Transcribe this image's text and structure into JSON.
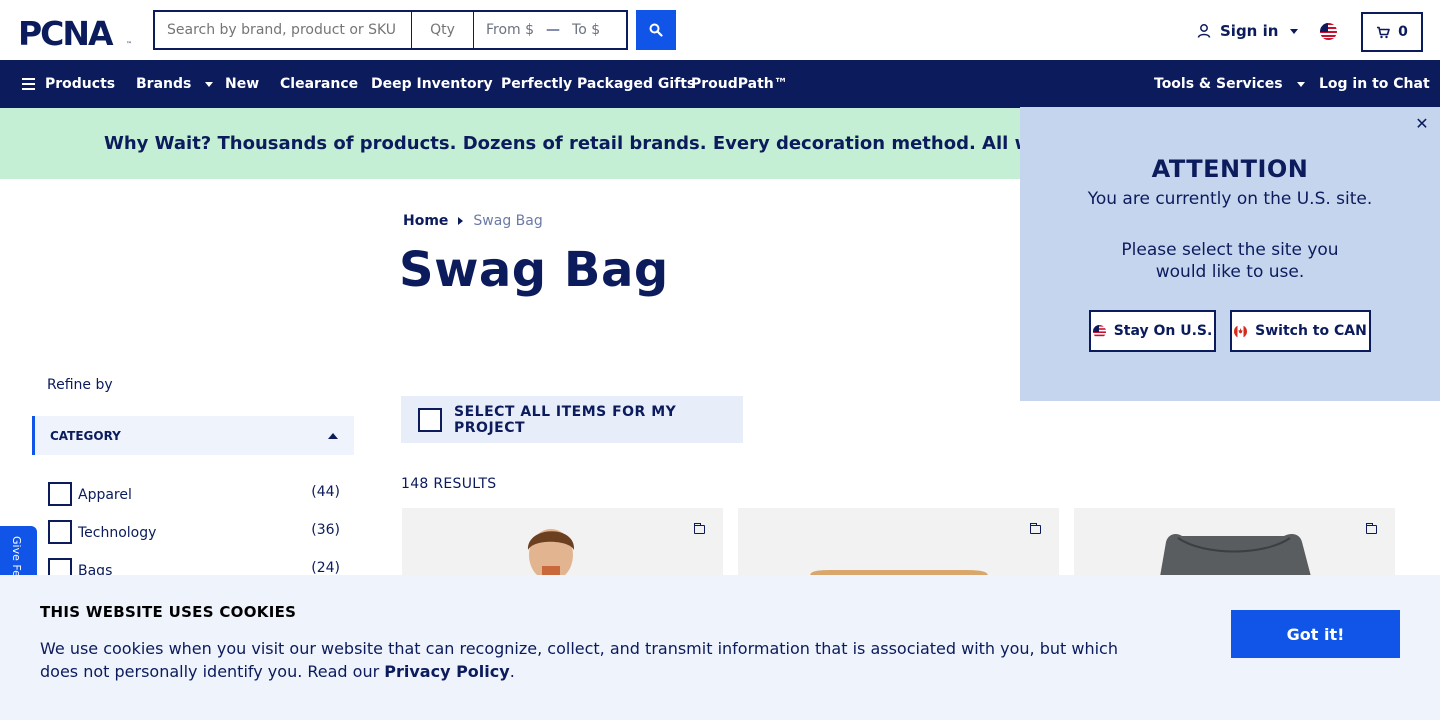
{
  "header": {
    "logo_text": "PCNA",
    "search_placeholder": "Search by brand, product or SKU",
    "qty_placeholder": "Qty",
    "price_from": "From $",
    "price_to": "To $",
    "sign_in": "Sign in",
    "cart_count": "0"
  },
  "nav": {
    "items": [
      {
        "label": "Products"
      },
      {
        "label": "Brands"
      },
      {
        "label": "New"
      },
      {
        "label": "Clearance"
      },
      {
        "label": "Deep Inventory"
      },
      {
        "label": "Perfectly Packaged Gifts"
      },
      {
        "label": "ProudPath™"
      }
    ],
    "tools": "Tools & Services",
    "chat": "Log in to Chat"
  },
  "promo": {
    "text": "Why Wait? Thousands of products. Dozens of retail brands. Every decoration method. All with a standard"
  },
  "breadcrumb": {
    "home": "Home",
    "current": "Swag Bag"
  },
  "page_title": "Swag Bag",
  "sidebar": {
    "refine_label": "Refine by",
    "category_header": "CATEGORY",
    "filters": [
      {
        "label": "Apparel",
        "count": "(44)"
      },
      {
        "label": "Technology",
        "count": "(36)"
      },
      {
        "label": "Bags",
        "count": "(24)"
      }
    ],
    "feedback": "Give Feedback"
  },
  "results": {
    "select_all": "SELECT ALL ITEMS FOR MY PROJECT",
    "count_text": "148 RESULTS"
  },
  "attention": {
    "title": "ATTENTION",
    "message1": "You are currently on the U.S. site.",
    "message2": "Please select the site you would like to use.",
    "stay_label": "Stay On U.S.",
    "switch_label": "Switch to CAN"
  },
  "cookie": {
    "title": "THIS WEBSITE USES COOKIES",
    "text": "We use cookies when you visit our website that can recognize, collect, and transmit information that is associated with you, but which does not personally identify you. Read our ",
    "link": "Privacy Policy",
    "text_end": ".",
    "button": "Got it!"
  },
  "colors": {
    "navy": "#0b1b5c",
    "blue": "#1054e8",
    "promo_bg": "#c5efd5",
    "popup_bg": "#c5d5ee",
    "cookie_bg": "#eef3fc"
  }
}
